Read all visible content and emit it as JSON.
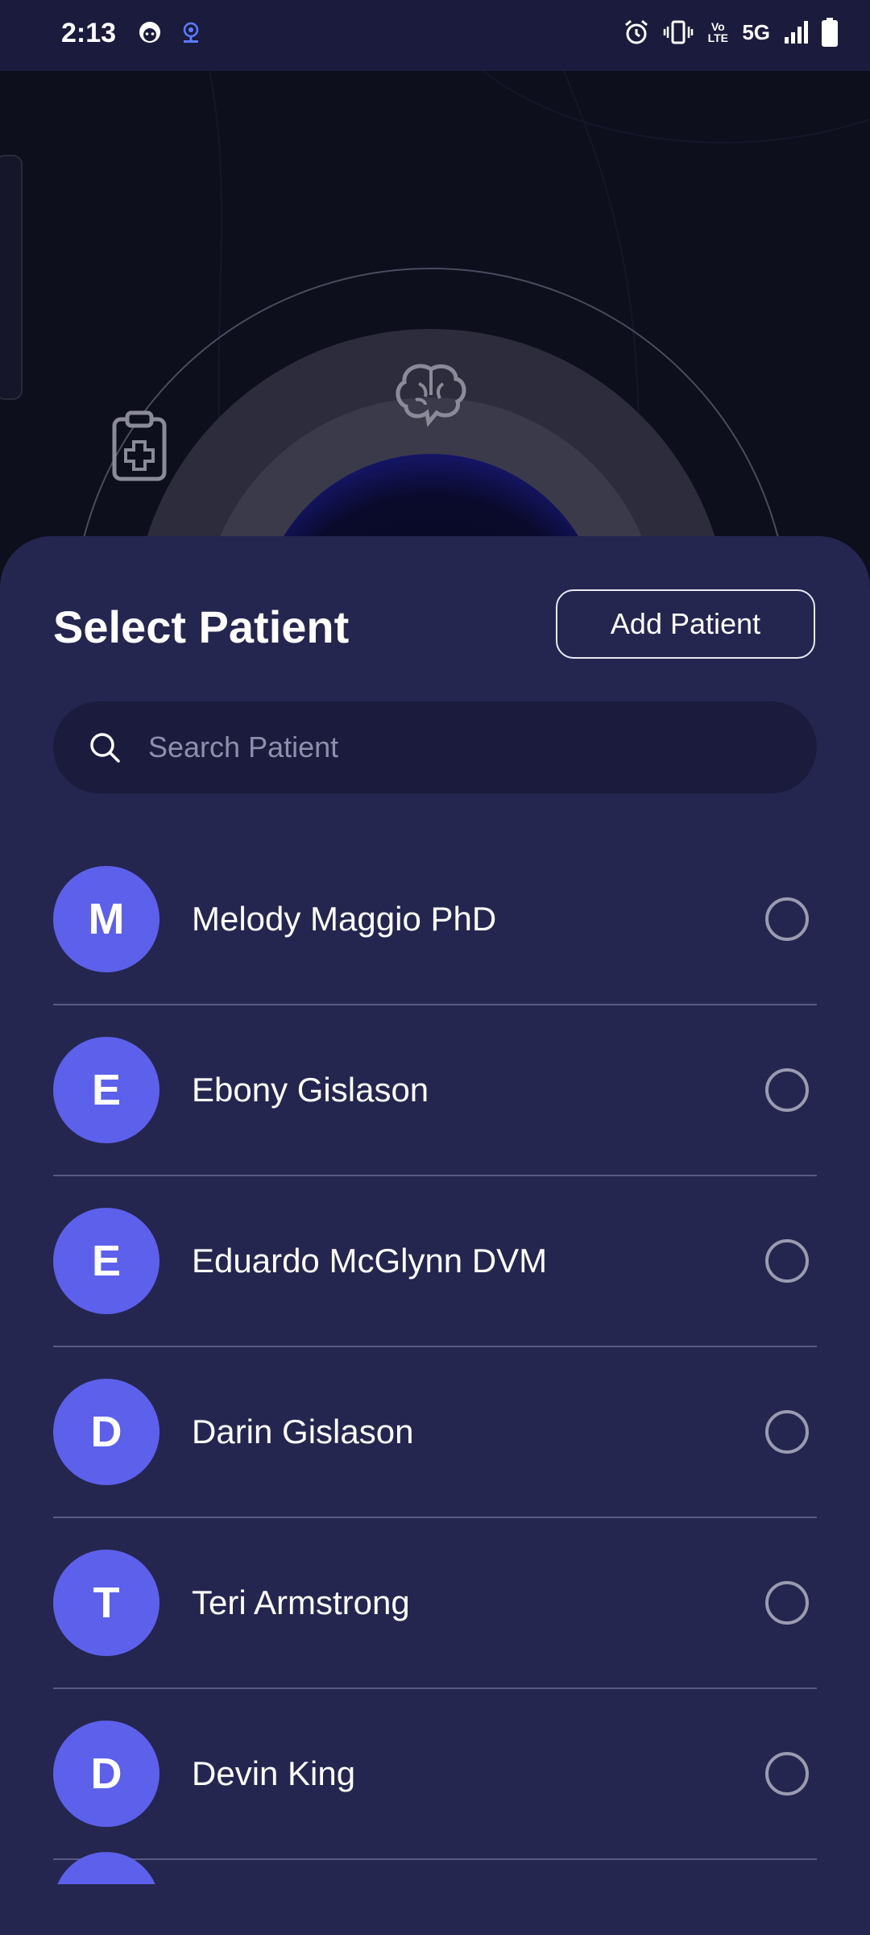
{
  "status_bar": {
    "time": "2:13",
    "network": "5G",
    "volte": "Vo LTE",
    "icons": [
      "face-icon",
      "podcast-icon",
      "alarm-icon",
      "vibrate-icon",
      "volte-icon",
      "signal-icon",
      "battery-icon"
    ]
  },
  "background": {
    "icons": [
      "clipboard-medical-icon",
      "brain-chat-icon"
    ]
  },
  "sheet": {
    "title": "Select Patient",
    "add_button_label": "Add Patient",
    "search": {
      "placeholder": "Search Patient",
      "value": ""
    },
    "patients": [
      {
        "initial": "M",
        "name": "Melody Maggio PhD",
        "selected": false
      },
      {
        "initial": "E",
        "name": "Ebony Gislason",
        "selected": false
      },
      {
        "initial": "E",
        "name": "Eduardo McGlynn DVM",
        "selected": false
      },
      {
        "initial": "D",
        "name": "Darin Gislason",
        "selected": false
      },
      {
        "initial": "T",
        "name": "Teri Armstrong",
        "selected": false
      },
      {
        "initial": "D",
        "name": "Devin King",
        "selected": false
      }
    ]
  },
  "colors": {
    "sheet_bg": "#25264f",
    "status_bg": "#1b1c3d",
    "avatar": "#5d60ea",
    "divider": "#585a86"
  }
}
